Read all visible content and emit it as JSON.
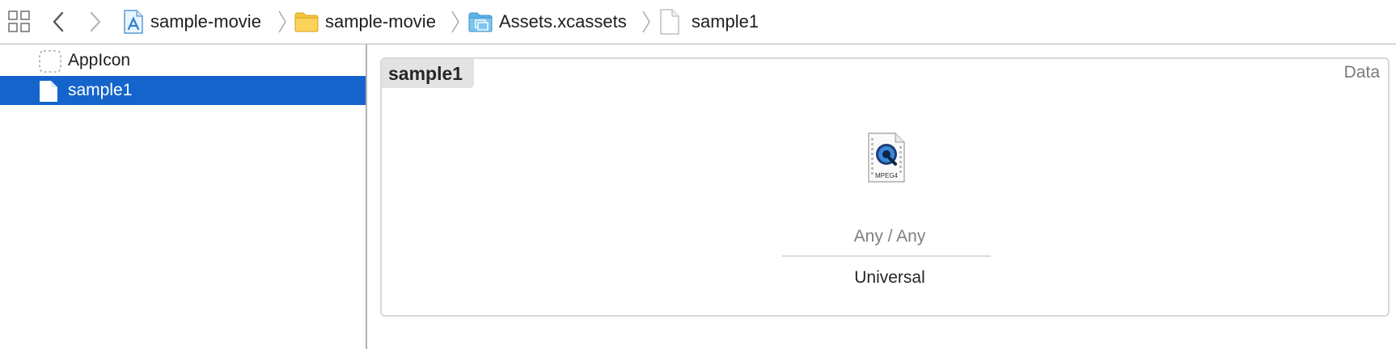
{
  "toolbar": {
    "breadcrumbs": [
      {
        "label": "sample-movie",
        "icon": "xcode-project-icon"
      },
      {
        "label": "sample-movie",
        "icon": "folder-icon"
      },
      {
        "label": "Assets.xcassets",
        "icon": "asset-catalog-icon"
      },
      {
        "label": "sample1",
        "icon": "file-icon"
      }
    ]
  },
  "navigator": {
    "items": [
      {
        "label": "AppIcon",
        "icon": "app-icon-placeholder-icon",
        "selected": false
      },
      {
        "label": "sample1",
        "icon": "data-set-icon",
        "selected": true
      }
    ]
  },
  "editor": {
    "asset_name": "sample1",
    "type_label": "Data",
    "file_badge": "MPEG4",
    "slot_label": "Any / Any",
    "device_label": "Universal"
  },
  "colors": {
    "selection": "#1464cc",
    "folder": "#f7c53b",
    "asset_catalog": "#5fb4e8"
  }
}
